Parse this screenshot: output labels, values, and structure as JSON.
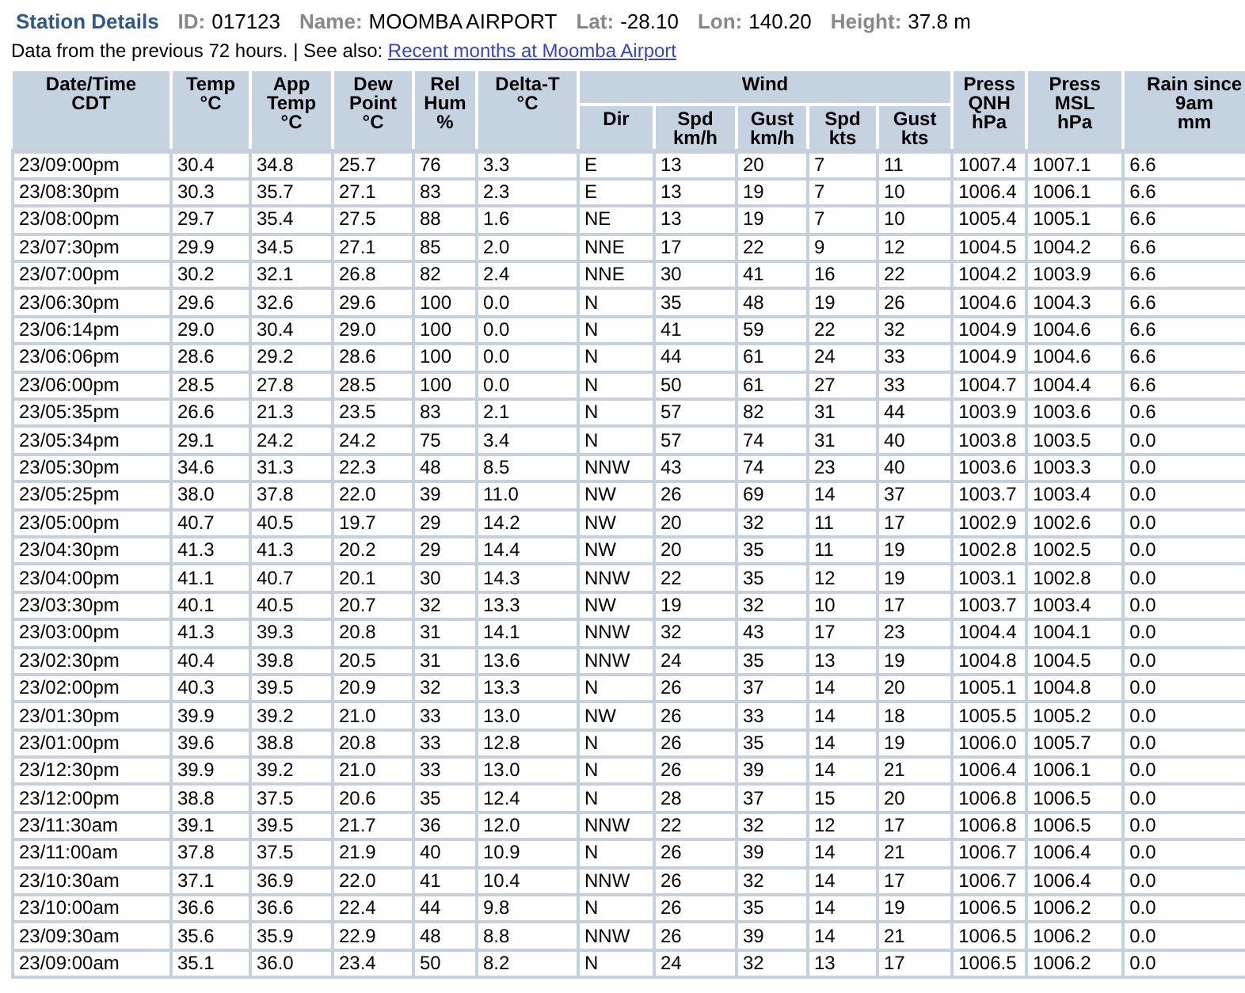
{
  "station": {
    "title": "Station Details",
    "fields": [
      {
        "label": "ID:",
        "value": "017123"
      },
      {
        "label": "Name:",
        "value": "MOOMBA AIRPORT"
      },
      {
        "label": "Lat:",
        "value": "-28.10"
      },
      {
        "label": "Lon:",
        "value": "140.20"
      },
      {
        "label": "Height:",
        "value": "37.8 m"
      }
    ]
  },
  "intro": {
    "text": "Data from the previous 72 hours. | See also:",
    "link": "Recent months at Moomba Airport"
  },
  "table": {
    "header_rows": [
      [
        {
          "lines": [
            "Date/Time",
            "CDT"
          ],
          "rowspan": 2
        },
        {
          "lines": [
            "Temp",
            "°C"
          ],
          "rowspan": 2
        },
        {
          "lines": [
            "App",
            "Temp",
            "°C"
          ],
          "rowspan": 2
        },
        {
          "lines": [
            "Dew",
            "Point",
            "°C"
          ],
          "rowspan": 2
        },
        {
          "lines": [
            "Rel",
            "Hum",
            "%"
          ],
          "rowspan": 2
        },
        {
          "lines": [
            "Delta-T",
            "°C"
          ],
          "rowspan": 2
        },
        {
          "lines": [
            "Wind"
          ],
          "colspan": 5
        },
        {
          "lines": [
            "Press",
            "QNH",
            "hPa"
          ],
          "rowspan": 2
        },
        {
          "lines": [
            "Press",
            "MSL",
            "hPa"
          ],
          "rowspan": 2
        },
        {
          "lines": [
            "Rain since",
            "9am",
            "mm"
          ],
          "rowspan": 2
        }
      ],
      [
        {
          "lines": [
            "Dir"
          ]
        },
        {
          "lines": [
            "Spd",
            "km/h"
          ]
        },
        {
          "lines": [
            "Gust",
            "km/h"
          ]
        },
        {
          "lines": [
            "Spd",
            "kts"
          ]
        },
        {
          "lines": [
            "Gust",
            "kts"
          ]
        }
      ]
    ],
    "rows": [
      [
        "23/09:00pm",
        "30.4",
        "34.8",
        "25.7",
        "76",
        "3.3",
        "E",
        "13",
        "20",
        "7",
        "11",
        "1007.4",
        "1007.1",
        "6.6"
      ],
      [
        "23/08:30pm",
        "30.3",
        "35.7",
        "27.1",
        "83",
        "2.3",
        "E",
        "13",
        "19",
        "7",
        "10",
        "1006.4",
        "1006.1",
        "6.6"
      ],
      [
        "23/08:00pm",
        "29.7",
        "35.4",
        "27.5",
        "88",
        "1.6",
        "NE",
        "13",
        "19",
        "7",
        "10",
        "1005.4",
        "1005.1",
        "6.6"
      ],
      [
        "23/07:30pm",
        "29.9",
        "34.5",
        "27.1",
        "85",
        "2.0",
        "NNE",
        "17",
        "22",
        "9",
        "12",
        "1004.5",
        "1004.2",
        "6.6"
      ],
      [
        "23/07:00pm",
        "30.2",
        "32.1",
        "26.8",
        "82",
        "2.4",
        "NNE",
        "30",
        "41",
        "16",
        "22",
        "1004.2",
        "1003.9",
        "6.6"
      ],
      [
        "23/06:30pm",
        "29.6",
        "32.6",
        "29.6",
        "100",
        "0.0",
        "N",
        "35",
        "48",
        "19",
        "26",
        "1004.6",
        "1004.3",
        "6.6"
      ],
      [
        "23/06:14pm",
        "29.0",
        "30.4",
        "29.0",
        "100",
        "0.0",
        "N",
        "41",
        "59",
        "22",
        "32",
        "1004.9",
        "1004.6",
        "6.6"
      ],
      [
        "23/06:06pm",
        "28.6",
        "29.2",
        "28.6",
        "100",
        "0.0",
        "N",
        "44",
        "61",
        "24",
        "33",
        "1004.9",
        "1004.6",
        "6.6"
      ],
      [
        "23/06:00pm",
        "28.5",
        "27.8",
        "28.5",
        "100",
        "0.0",
        "N",
        "50",
        "61",
        "27",
        "33",
        "1004.7",
        "1004.4",
        "6.6"
      ],
      [
        "23/05:35pm",
        "26.6",
        "21.3",
        "23.5",
        "83",
        "2.1",
        "N",
        "57",
        "82",
        "31",
        "44",
        "1003.9",
        "1003.6",
        "0.6"
      ],
      [
        "23/05:34pm",
        "29.1",
        "24.2",
        "24.2",
        "75",
        "3.4",
        "N",
        "57",
        "74",
        "31",
        "40",
        "1003.8",
        "1003.5",
        "0.0"
      ],
      [
        "23/05:30pm",
        "34.6",
        "31.3",
        "22.3",
        "48",
        "8.5",
        "NNW",
        "43",
        "74",
        "23",
        "40",
        "1003.6",
        "1003.3",
        "0.0"
      ],
      [
        "23/05:25pm",
        "38.0",
        "37.8",
        "22.0",
        "39",
        "11.0",
        "NW",
        "26",
        "69",
        "14",
        "37",
        "1003.7",
        "1003.4",
        "0.0"
      ],
      [
        "23/05:00pm",
        "40.7",
        "40.5",
        "19.7",
        "29",
        "14.2",
        "NW",
        "20",
        "32",
        "11",
        "17",
        "1002.9",
        "1002.6",
        "0.0"
      ],
      [
        "23/04:30pm",
        "41.3",
        "41.3",
        "20.2",
        "29",
        "14.4",
        "NW",
        "20",
        "35",
        "11",
        "19",
        "1002.8",
        "1002.5",
        "0.0"
      ],
      [
        "23/04:00pm",
        "41.1",
        "40.7",
        "20.1",
        "30",
        "14.3",
        "NNW",
        "22",
        "35",
        "12",
        "19",
        "1003.1",
        "1002.8",
        "0.0"
      ],
      [
        "23/03:30pm",
        "40.1",
        "40.5",
        "20.7",
        "32",
        "13.3",
        "NW",
        "19",
        "32",
        "10",
        "17",
        "1003.7",
        "1003.4",
        "0.0"
      ],
      [
        "23/03:00pm",
        "41.3",
        "39.3",
        "20.8",
        "31",
        "14.1",
        "NNW",
        "32",
        "43",
        "17",
        "23",
        "1004.4",
        "1004.1",
        "0.0"
      ],
      [
        "23/02:30pm",
        "40.4",
        "39.8",
        "20.5",
        "31",
        "13.6",
        "NNW",
        "24",
        "35",
        "13",
        "19",
        "1004.8",
        "1004.5",
        "0.0"
      ],
      [
        "23/02:00pm",
        "40.3",
        "39.5",
        "20.9",
        "32",
        "13.3",
        "N",
        "26",
        "37",
        "14",
        "20",
        "1005.1",
        "1004.8",
        "0.0"
      ],
      [
        "23/01:30pm",
        "39.9",
        "39.2",
        "21.0",
        "33",
        "13.0",
        "NW",
        "26",
        "33",
        "14",
        "18",
        "1005.5",
        "1005.2",
        "0.0"
      ],
      [
        "23/01:00pm",
        "39.6",
        "38.8",
        "20.8",
        "33",
        "12.8",
        "N",
        "26",
        "35",
        "14",
        "19",
        "1006.0",
        "1005.7",
        "0.0"
      ],
      [
        "23/12:30pm",
        "39.9",
        "39.2",
        "21.0",
        "33",
        "13.0",
        "N",
        "26",
        "39",
        "14",
        "21",
        "1006.4",
        "1006.1",
        "0.0"
      ],
      [
        "23/12:00pm",
        "38.8",
        "37.5",
        "20.6",
        "35",
        "12.4",
        "N",
        "28",
        "37",
        "15",
        "20",
        "1006.8",
        "1006.5",
        "0.0"
      ],
      [
        "23/11:30am",
        "39.1",
        "39.5",
        "21.7",
        "36",
        "12.0",
        "NNW",
        "22",
        "32",
        "12",
        "17",
        "1006.8",
        "1006.5",
        "0.0"
      ],
      [
        "23/11:00am",
        "37.8",
        "37.5",
        "21.9",
        "40",
        "10.9",
        "N",
        "26",
        "39",
        "14",
        "21",
        "1006.7",
        "1006.4",
        "0.0"
      ],
      [
        "23/10:30am",
        "37.1",
        "36.9",
        "22.0",
        "41",
        "10.4",
        "NNW",
        "26",
        "32",
        "14",
        "17",
        "1006.7",
        "1006.4",
        "0.0"
      ],
      [
        "23/10:00am",
        "36.6",
        "36.6",
        "22.4",
        "44",
        "9.8",
        "N",
        "26",
        "35",
        "14",
        "19",
        "1006.5",
        "1006.2",
        "0.0"
      ],
      [
        "23/09:30am",
        "35.6",
        "35.9",
        "22.9",
        "48",
        "8.8",
        "NNW",
        "26",
        "39",
        "14",
        "21",
        "1006.5",
        "1006.2",
        "0.0"
      ],
      [
        "23/09:00am",
        "35.1",
        "36.0",
        "23.4",
        "50",
        "8.2",
        "N",
        "24",
        "32",
        "13",
        "17",
        "1006.5",
        "1006.2",
        "0.0"
      ]
    ]
  }
}
